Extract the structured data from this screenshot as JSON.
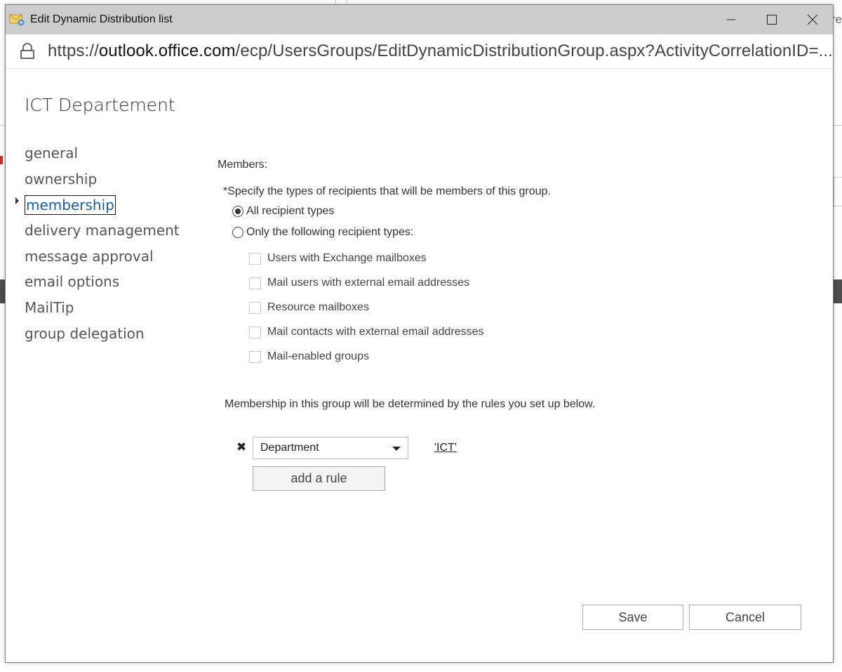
{
  "window": {
    "title": "Edit Dynamic Distribution list",
    "url_prefix": "https://",
    "url_host": "outlook.office.com",
    "url_path": "/ecp/UsersGroups/EditDynamicDistributionGroup.aspx?ActivityCorrelationID=...",
    "icons": {
      "app": "mail-envelope-icon",
      "lock": "lock-icon",
      "minimize": "minimize-icon",
      "maximize": "maximize-icon",
      "close": "close-icon"
    }
  },
  "background": {
    "peek_text": "re"
  },
  "page": {
    "title": "ICT Departement"
  },
  "nav": {
    "items": [
      {
        "label": "general"
      },
      {
        "label": "ownership"
      },
      {
        "label": "membership",
        "active": true
      },
      {
        "label": "delivery management"
      },
      {
        "label": "message approval"
      },
      {
        "label": "email options"
      },
      {
        "label": "MailTip"
      },
      {
        "label": "group delegation"
      }
    ]
  },
  "membership": {
    "members_label": "Members:",
    "specify_text": "*Specify the types of recipients that will be members of this group.",
    "radio_all": {
      "label": "All recipient types",
      "selected": true
    },
    "radio_only": {
      "label": "Only the following recipient types:",
      "selected": false
    },
    "recipient_types": [
      {
        "label": "Users with Exchange mailboxes",
        "checked": false
      },
      {
        "label": "Mail users with external email addresses",
        "checked": false
      },
      {
        "label": "Resource mailboxes",
        "checked": false
      },
      {
        "label": "Mail contacts with external email addresses",
        "checked": false
      },
      {
        "label": "Mail-enabled groups",
        "checked": false
      }
    ],
    "rules_text": "Membership in this group will be determined by the rules you set up below.",
    "rule": {
      "remove_symbol": "✖",
      "attribute": "Department",
      "value": "'ICT'"
    },
    "add_rule_label": "add a rule"
  },
  "footer": {
    "save_label": "Save",
    "cancel_label": "Cancel"
  },
  "colors": {
    "titlebar_bg": "#cccccc",
    "active_nav": "#1a5fa6",
    "text": "#333333"
  }
}
